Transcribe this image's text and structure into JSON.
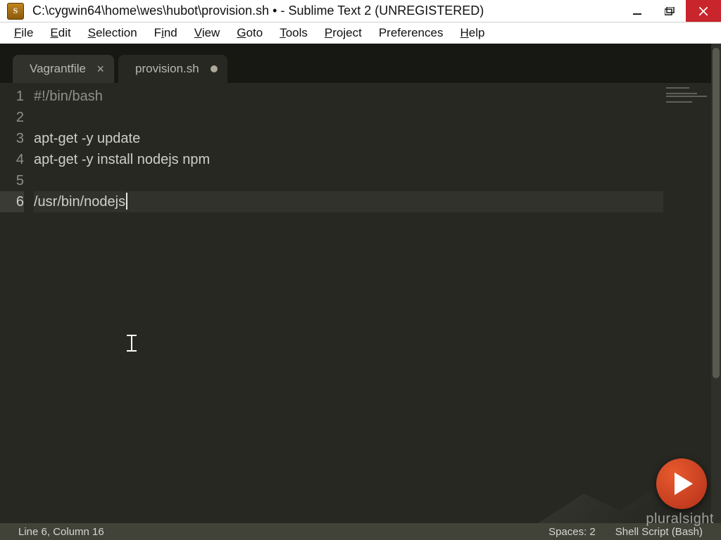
{
  "title": "C:\\cygwin64\\home\\wes\\hubot\\provision.sh • - Sublime Text 2 (UNREGISTERED)",
  "app_icon_letter": "S",
  "menu": {
    "items": [
      "File",
      "Edit",
      "Selection",
      "Find",
      "View",
      "Goto",
      "Tools",
      "Project",
      "Preferences",
      "Help"
    ]
  },
  "tabs": [
    {
      "label": "Vagrantfile",
      "active": false,
      "dirty": false
    },
    {
      "label": "provision.sh",
      "active": true,
      "dirty": true
    }
  ],
  "code": {
    "lines": [
      {
        "n": 1,
        "text": "#!/bin/bash",
        "comment": true
      },
      {
        "n": 2,
        "text": ""
      },
      {
        "n": 3,
        "text": "apt-get -y update"
      },
      {
        "n": 4,
        "text": "apt-get -y install nodejs npm"
      },
      {
        "n": 5,
        "text": ""
      },
      {
        "n": 6,
        "text": "/usr/bin/nodejs",
        "active": true,
        "cursor_after": true
      }
    ]
  },
  "status": {
    "left": "Line 6, Column 16",
    "spaces": "Spaces: 2",
    "syntax": "Shell Script (Bash)"
  },
  "watermark": "pluralsight"
}
